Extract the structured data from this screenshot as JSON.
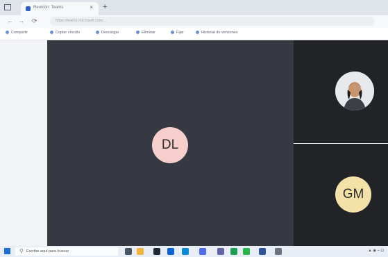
{
  "browser": {
    "tab_title": "Reunión: Teams",
    "tab_close": "×",
    "new_tab": "+",
    "nav": {
      "back": "←",
      "forward": "→",
      "refresh": "⟳"
    },
    "url": "https://teams.microsoft.com/..."
  },
  "command_bar": {
    "items": [
      "Compartir",
      "Copiar vínculo",
      "Descargar",
      "Eliminar",
      "Fijar",
      "Historial de versiones"
    ]
  },
  "meeting": {
    "main_participant": {
      "initials": "DL",
      "color": "#f6cfcc"
    },
    "side_participants": [
      {
        "kind": "photo",
        "icon": "person-photo"
      },
      {
        "initials": "GM",
        "color": "#f4e1a7"
      }
    ]
  },
  "taskbar": {
    "search_placeholder": "Escribe aquí para buscar",
    "icons": [
      "task-view-icon",
      "file-explorer-icon",
      "store-icon",
      "mail-icon",
      "edge-icon",
      "calendar-icon",
      "teams-icon",
      "chrome-icon",
      "spotify-icon",
      "word-icon",
      "settings-icon"
    ]
  },
  "colors": {
    "stage_bg": "#363842",
    "tile_bg": "#222326",
    "accent": "#2d62c8"
  }
}
